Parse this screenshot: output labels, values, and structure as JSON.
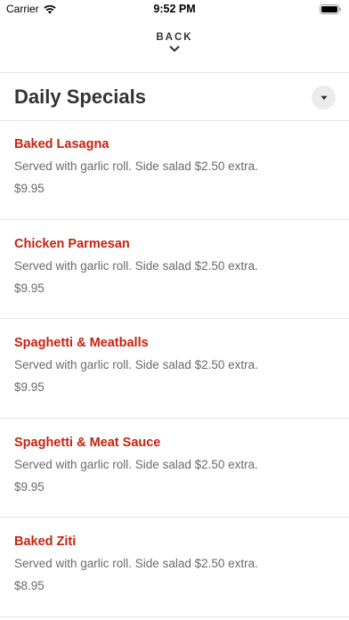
{
  "status_bar": {
    "carrier": "Carrier",
    "time": "9:52 PM"
  },
  "nav": {
    "back_label": "BACK"
  },
  "section": {
    "title": "Daily Specials"
  },
  "items": [
    {
      "name": "Baked Lasagna",
      "description": "Served with garlic roll. Side salad $2.50 extra.",
      "price": "$9.95"
    },
    {
      "name": "Chicken Parmesan",
      "description": "Served with garlic roll. Side salad $2.50 extra.",
      "price": "$9.95"
    },
    {
      "name": "Spaghetti & Meatballs",
      "description": "Served with garlic roll. Side salad $2.50 extra.",
      "price": "$9.95"
    },
    {
      "name": "Spaghetti & Meat Sauce",
      "description": "Served with garlic roll. Side salad $2.50 extra.",
      "price": "$9.95"
    },
    {
      "name": "Baked Ziti",
      "description": "Served with garlic roll. Side salad $2.50 extra.",
      "price": "$8.95"
    }
  ],
  "colors": {
    "accent": "#c8210f",
    "text": "#333333",
    "muted": "#6b6b6b"
  }
}
